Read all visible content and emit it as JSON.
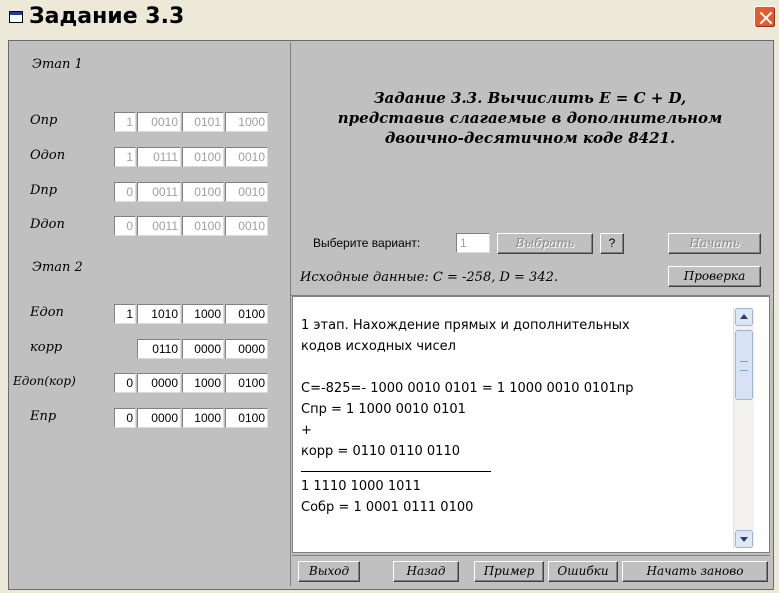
{
  "window": {
    "title": "Задание 3.3"
  },
  "left": {
    "stage1": "Этап 1",
    "stage2": "Этап 2",
    "rows1": [
      {
        "label": "Опр",
        "cells": [
          "1",
          "0010",
          "0101",
          "1000"
        ]
      },
      {
        "label": "Одоп",
        "cells": [
          "1",
          "0111",
          "0100",
          "0010"
        ]
      },
      {
        "label": "Dпр",
        "cells": [
          "0",
          "0011",
          "0100",
          "0010"
        ]
      },
      {
        "label": "Dдоп",
        "cells": [
          "0",
          "0011",
          "0100",
          "0010"
        ]
      }
    ],
    "rows2": [
      {
        "label": "Eдоп",
        "cells": [
          "1",
          "1010",
          "1000",
          "0100"
        ]
      },
      {
        "label": "корр",
        "cells": [
          "0110",
          "0000",
          "0000"
        ]
      },
      {
        "label": "Eдоп(кор)",
        "cells": [
          "0",
          "0000",
          "1000",
          "0100"
        ]
      },
      {
        "label": "Eпр",
        "cells": [
          "0",
          "0000",
          "1000",
          "0100"
        ]
      }
    ]
  },
  "task": {
    "line1": "Задание 3.3. Вычислить E = C + D,",
    "line2": "представив слагаемые в дополнительном",
    "line3": "двоично-десятичном коде 8421."
  },
  "controls": {
    "variant_label": "Выберите вариант:",
    "variant_value": "1",
    "choose": "Выбрать",
    "help": "?",
    "start": "Начать",
    "initial_label": "Исходные данные: C = -258, D = 342.",
    "check": "Проверка"
  },
  "log": {
    "lines": [
      "1 этап. Нахождение прямых и дополнительных",
      "кодов исходных чисел",
      "",
      "С=-825=- 1000 0010 0101 = 1 1000 0010 0101пр",
      "Спр = 1 1000 0010 0101",
      "+",
      "корр = 0110 0110 0110",
      "",
      "1 1110 1000 1011",
      "Собр = 1 0001 0111 0100"
    ]
  },
  "bottom": {
    "exit": "Выход",
    "back": "Назад",
    "example": "Пример",
    "errors": "Ошибки",
    "restart": "Начать заново"
  }
}
